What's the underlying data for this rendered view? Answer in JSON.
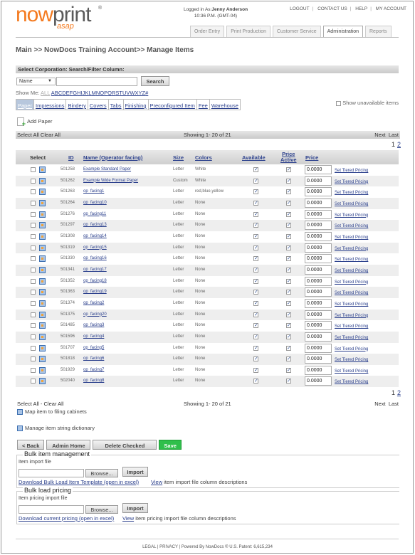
{
  "header": {
    "logo_main": "nowprint",
    "logo_sub": "asap",
    "logo_tm": "®",
    "login_prefix": "Logged in As:",
    "user_name": "Jenny Anderson",
    "login_time": "10:36 P.M. (GMT-04)",
    "top_links": [
      "LOGOUT",
      "CONTACT US",
      "HELP",
      "MY ACCOUNT"
    ],
    "tabs": [
      "Order Entry",
      "Print Production",
      "Customer Service",
      "Administration",
      "Reports"
    ],
    "active_tab": "Administration"
  },
  "breadcrumb": "Main >> NowDocs Training Account>> Manage Items",
  "filter": {
    "bar_title": "Select Corporation: Search/Filter Column:",
    "column_select": "Name",
    "search_value": "",
    "search_button": "Search",
    "show_me_label": "Show Me:",
    "show_me_all": "ALL",
    "letters": [
      "A",
      "B",
      "C",
      "D",
      "E",
      "F",
      "G",
      "H",
      "I",
      "J",
      "K",
      "L",
      "M",
      "N",
      "O",
      "P",
      "Q",
      "R",
      "S",
      "T",
      "U",
      "V",
      "W",
      "X",
      "Y",
      "Z",
      "#"
    ],
    "item_tabs": [
      "Paper",
      "Impressions",
      "Bindery",
      "Covers",
      "Tabs",
      "Finishing",
      "Preconfigured Item",
      "Fee",
      "Warehouse"
    ],
    "active_item_tab": "Paper",
    "show_unavailable": "Show unavailable items",
    "add_label": "Add Paper"
  },
  "paging": {
    "select_all_top": "Select All Clear All",
    "select_all_bottom": "Select All  - Clear All",
    "showing": "Showing 1- 20 of 21",
    "next": "Next",
    "last": "Last",
    "pages": [
      "1",
      "2"
    ]
  },
  "table": {
    "headers": {
      "select": "Select",
      "id": "ID",
      "name": "Name (Operator facing)",
      "size": "Size",
      "colors": "Colors",
      "available": "Available",
      "price_active_1": "Price",
      "price_active_2": "Active",
      "price": "Price"
    },
    "tier_link": "Set Tiered Pricing",
    "rows": [
      {
        "id": "501258",
        "name": "Example Standard Paper",
        "size": "Letter",
        "colors": "White",
        "price": "0.0000"
      },
      {
        "id": "501262",
        "name": "Example Wide Format Paper",
        "size": "Custom",
        "colors": "White",
        "price": "0.0000"
      },
      {
        "id": "501263",
        "name": "op_facing1",
        "size": "Letter",
        "colors": "red,blue,yellow",
        "price": "0.0000"
      },
      {
        "id": "501264",
        "name": "op_facing10",
        "size": "Letter",
        "colors": "None",
        "price": "0.0000"
      },
      {
        "id": "501276",
        "name": "op_facing11",
        "size": "Letter",
        "colors": "None",
        "price": "0.0000"
      },
      {
        "id": "501297",
        "name": "op_facing13",
        "size": "Letter",
        "colors": "None",
        "price": "0.0000"
      },
      {
        "id": "501308",
        "name": "op_facing14",
        "size": "Letter",
        "colors": "None",
        "price": "0.0000"
      },
      {
        "id": "501319",
        "name": "op_facing15",
        "size": "Letter",
        "colors": "None",
        "price": "0.0000"
      },
      {
        "id": "501330",
        "name": "op_facing16",
        "size": "Letter",
        "colors": "None",
        "price": "0.0000"
      },
      {
        "id": "501341",
        "name": "op_facing17",
        "size": "Letter",
        "colors": "None",
        "price": "0.0000"
      },
      {
        "id": "501352",
        "name": "op_facing18",
        "size": "Letter",
        "colors": "None",
        "price": "0.0000"
      },
      {
        "id": "501363",
        "name": "op_facing19",
        "size": "Letter",
        "colors": "None",
        "price": "0.0000"
      },
      {
        "id": "501374",
        "name": "op_facing2",
        "size": "Letter",
        "colors": "None",
        "price": "0.0000"
      },
      {
        "id": "501375",
        "name": "op_facing20",
        "size": "Letter",
        "colors": "None",
        "price": "0.0000"
      },
      {
        "id": "501485",
        "name": "op_facing3",
        "size": "Letter",
        "colors": "None",
        "price": "0.0000"
      },
      {
        "id": "501596",
        "name": "op_facing4",
        "size": "Letter",
        "colors": "None",
        "price": "0.0000"
      },
      {
        "id": "501707",
        "name": "op_facing5",
        "size": "Letter",
        "colors": "None",
        "price": "0.0000"
      },
      {
        "id": "501818",
        "name": "op_facing6",
        "size": "Letter",
        "colors": "None",
        "price": "0.0000"
      },
      {
        "id": "501929",
        "name": "op_facing7",
        "size": "Letter",
        "colors": "None",
        "price": "0.0000"
      },
      {
        "id": "502040",
        "name": "op_facing8",
        "size": "Letter",
        "colors": "None",
        "price": "0.0000"
      }
    ]
  },
  "links": {
    "map_filing": "Map item to filing cabinets",
    "manage_dictionary": "Manage item string dictionary"
  },
  "actions": {
    "back": "< Back",
    "admin_home": "Admin Home",
    "delete_checked": "Delete Checked",
    "save": "Save"
  },
  "bulk": {
    "title": "Bulk item management",
    "file_label": "Item import file",
    "browse": "Browse...",
    "import": "Import",
    "download": "Download Bulk Load Item Template (open in excel)",
    "view_link": "View",
    "view_text": "item import file column descriptions"
  },
  "pricing": {
    "title": "Bulk load pricing",
    "file_label": "Item pricing import file",
    "browse": "Browse...",
    "import": "Import",
    "download": "Download current pricing (open in excel)",
    "view_link": "View",
    "view_text": "item pricing import file column descriptions"
  },
  "footer": {
    "text": "LEGAL  | PRIVACY  | Powered By NowDocs ® U.S. Patent: 6,615,234"
  },
  "colors": {
    "brand_orange": "#f47a1f",
    "link_blue": "#2a3f8c",
    "save_green": "#2fbf4b"
  }
}
